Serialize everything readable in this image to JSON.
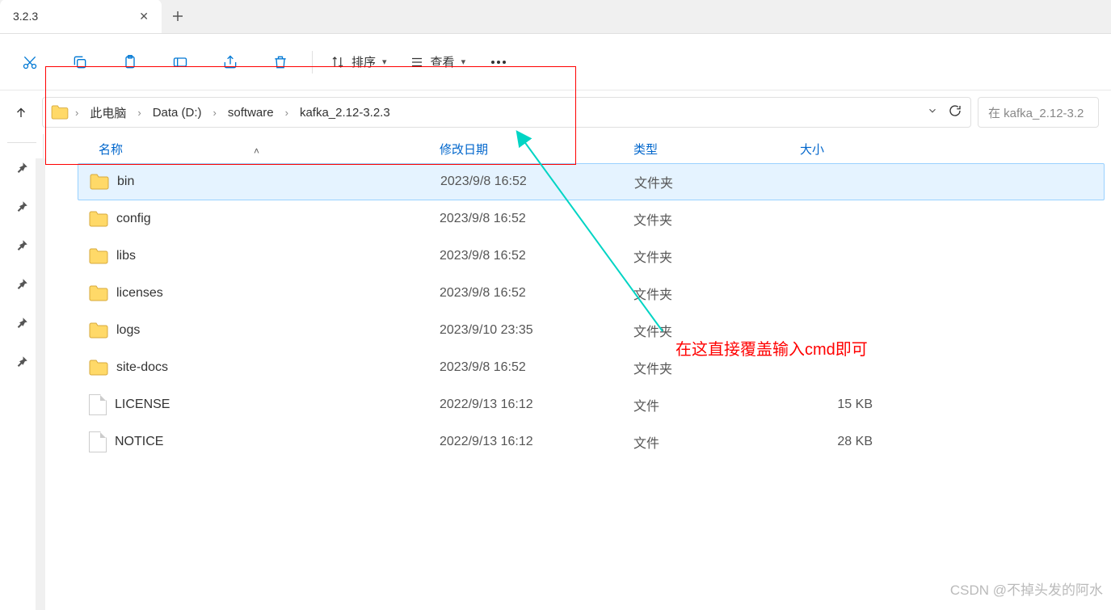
{
  "tab": {
    "title": "3.2.3"
  },
  "toolbar": {
    "sort_label": "排序",
    "view_label": "查看"
  },
  "breadcrumb": {
    "items": [
      "此电脑",
      "Data (D:)",
      "software",
      "kafka_2.12-3.2.3"
    ]
  },
  "search": {
    "placeholder": "在 kafka_2.12-3.2"
  },
  "columns": {
    "name": "名称",
    "date": "修改日期",
    "type": "类型",
    "size": "大小"
  },
  "files": [
    {
      "name": "bin",
      "date": "2023/9/8 16:52",
      "type": "文件夹",
      "size": "",
      "kind": "folder",
      "selected": true
    },
    {
      "name": "config",
      "date": "2023/9/8 16:52",
      "type": "文件夹",
      "size": "",
      "kind": "folder",
      "selected": false
    },
    {
      "name": "libs",
      "date": "2023/9/8 16:52",
      "type": "文件夹",
      "size": "",
      "kind": "folder",
      "selected": false
    },
    {
      "name": "licenses",
      "date": "2023/9/8 16:52",
      "type": "文件夹",
      "size": "",
      "kind": "folder",
      "selected": false
    },
    {
      "name": "logs",
      "date": "2023/9/10 23:35",
      "type": "文件夹",
      "size": "",
      "kind": "folder",
      "selected": false
    },
    {
      "name": "site-docs",
      "date": "2023/9/8 16:52",
      "type": "文件夹",
      "size": "",
      "kind": "folder",
      "selected": false
    },
    {
      "name": "LICENSE",
      "date": "2022/9/13 16:12",
      "type": "文件",
      "size": "15 KB",
      "kind": "file",
      "selected": false
    },
    {
      "name": "NOTICE",
      "date": "2022/9/13 16:12",
      "type": "文件",
      "size": "28 KB",
      "kind": "file",
      "selected": false
    }
  ],
  "annotation": {
    "text": "在这直接覆盖输入cmd即可"
  },
  "watermark": "CSDN @不掉头发的阿水"
}
